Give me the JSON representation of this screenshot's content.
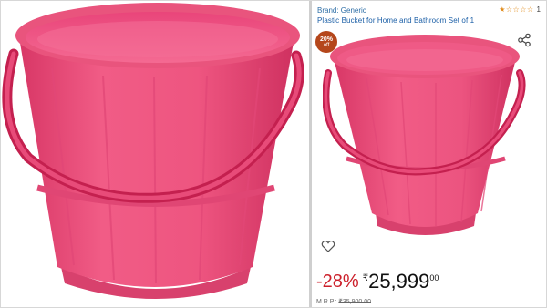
{
  "product": {
    "brand": "Brand: Generic",
    "title": "Plastic Bucket for Home and Bathroom Set of 1",
    "rating_stars": "★☆☆☆☆",
    "rating_count": "1"
  },
  "badge": {
    "percent": "20%",
    "off": "off"
  },
  "price": {
    "discount": "-28%",
    "currency": "₹",
    "whole": "25,999",
    "fraction": "00",
    "mrp_label": "M.R.P.:",
    "mrp_value": "₹35,900.00"
  },
  "icons": {
    "share": "share-icon",
    "heart": "heart-icon"
  },
  "colors": {
    "bucket_pink": "#ef4f7a",
    "discount_red": "#cc1f2a",
    "badge_brown": "#b5471b",
    "link_blue": "#1a5ea6",
    "star_orange": "#e08a18"
  }
}
